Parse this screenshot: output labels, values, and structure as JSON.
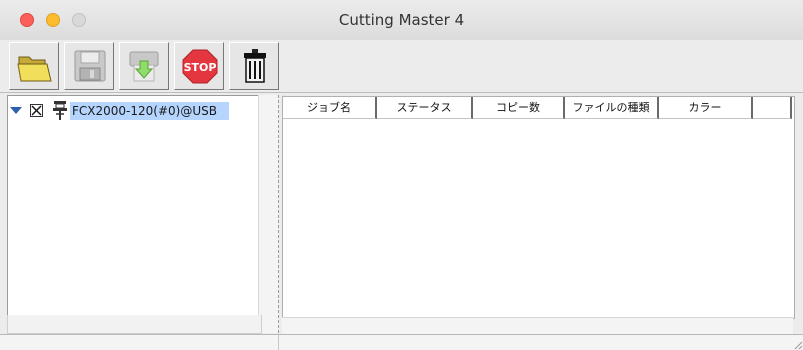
{
  "window": {
    "title": "Cutting Master 4"
  },
  "toolbar": {
    "buttons": [
      {
        "name": "open",
        "icon": "folder-icon"
      },
      {
        "name": "save",
        "icon": "floppy-disk-icon"
      },
      {
        "name": "send",
        "icon": "send-to-plotter-icon"
      },
      {
        "name": "stop",
        "icon": "stop-sign-icon",
        "text": "STOP"
      },
      {
        "name": "delete",
        "icon": "trash-can-icon"
      }
    ]
  },
  "device_tree": {
    "items": [
      {
        "label": "FCX2000-120(#0)@USB",
        "expanded": true,
        "checked": true,
        "selected": true,
        "icon": "cutter-device-icon"
      }
    ]
  },
  "job_table": {
    "columns": [
      "ジョブ名",
      "ステータス",
      "コピー数",
      "ファイルの種類",
      "カラー"
    ],
    "rows": []
  },
  "colors": {
    "selection": "#b5d5ff",
    "close": "#fc5f57",
    "minimize": "#fdbc2e",
    "stop": "#e4363f"
  }
}
